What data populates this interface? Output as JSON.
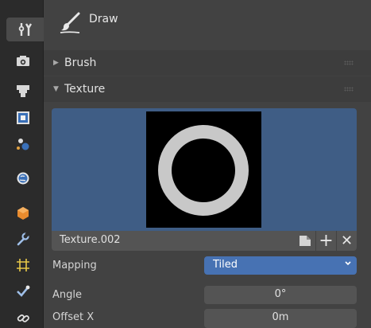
{
  "header": {
    "title": "Draw",
    "icon": "brush-stroke-icon"
  },
  "panels": {
    "brush": {
      "label": "Brush",
      "collapsed": true
    },
    "texture": {
      "label": "Texture",
      "collapsed": false
    }
  },
  "texture": {
    "name": "Texture.002",
    "preview_bg": "#3f5d85",
    "mapping_label": "Mapping",
    "mapping_value": "Tiled",
    "mapping_color": "#4772b3",
    "angle_label": "Angle",
    "angle_value": "0°",
    "offset_x_label": "Offset X",
    "offset_x_value": "0m"
  },
  "tabs": [
    "tool-icon",
    "render-icon",
    "output-icon",
    "view-layer-icon",
    "scene-icon",
    "world-icon",
    "object-icon",
    "modifier-icon",
    "particles-icon",
    "physics-icon",
    "constraints-icon"
  ]
}
